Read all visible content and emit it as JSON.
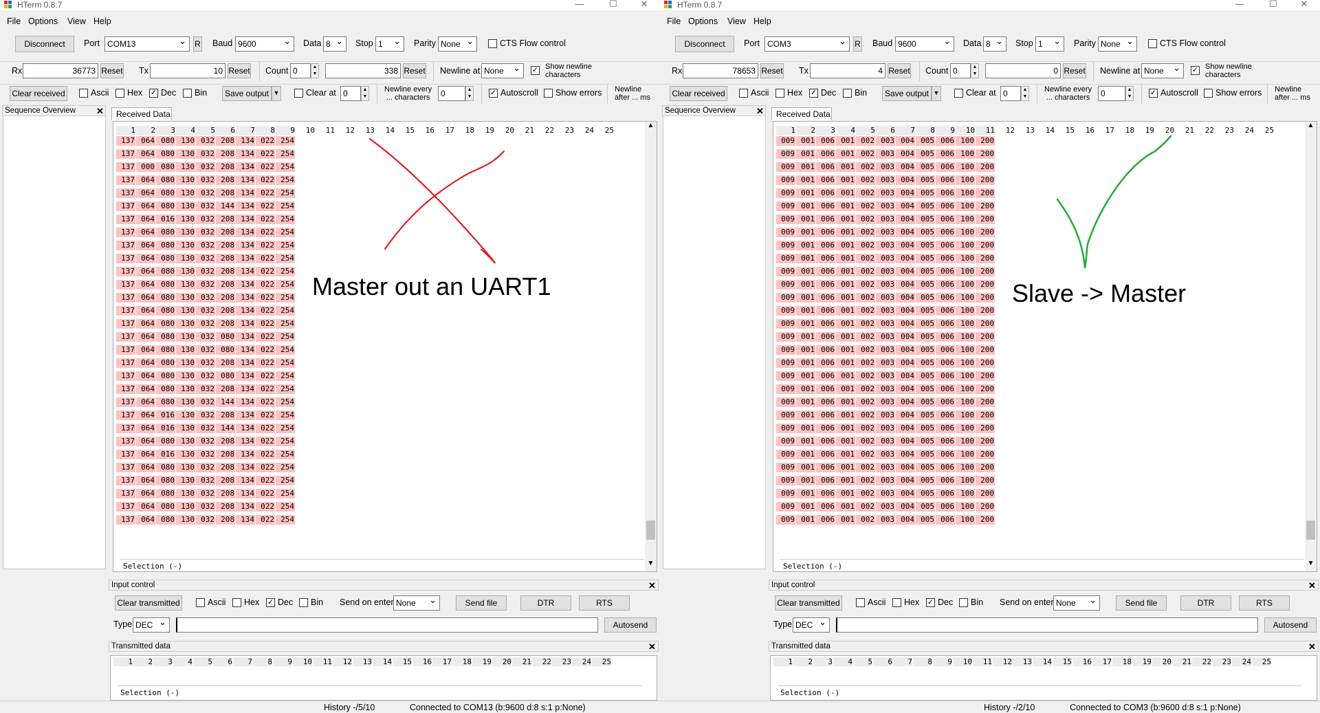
{
  "windows": [
    {
      "title": "HTerm 0.8.7",
      "menu": [
        "File",
        "Options",
        "View",
        "Help"
      ],
      "toolbar1": {
        "connect_label": "Disconnect",
        "port_label": "Port",
        "port_value": "COM13",
        "refresh_label": "R",
        "baud_label": "Baud",
        "baud_value": "9600",
        "data_label": "Data",
        "data_value": "8",
        "stop_label": "Stop",
        "stop_value": "1",
        "parity_label": "Parity",
        "parity_value": "None",
        "cts_label": "CTS Flow control",
        "cts_checked": false
      },
      "toolbar2": {
        "rx_label": "Rx",
        "rx_value": "36773",
        "rx_reset": "Reset",
        "tx_label": "Tx",
        "tx_value": "10",
        "tx_reset": "Reset",
        "count_label": "Count",
        "count_value": "0",
        "count_total": "338",
        "count_reset": "Reset",
        "newline_at_label": "Newline at",
        "newline_at_value": "None",
        "show_newline_line1": "Show newline",
        "show_newline_line2": "characters",
        "show_newline_checked": true
      },
      "toolbar3": {
        "clear_received": "Clear received",
        "ascii": "Ascii",
        "hex": "Hex",
        "dec": "Dec",
        "bin": "Bin",
        "save_output": "Save output",
        "clear_at": "Clear at",
        "clear_at_value": "0",
        "newline_every_line1": "Newline every",
        "newline_every_line2": "... characters",
        "newline_every_value": "0",
        "autoscroll": "Autoscroll",
        "show_errors": "Show errors",
        "newline_after_line1": "Newline",
        "newline_after_line2": "after ... ms"
      },
      "sequence_overview": "Sequence Overview",
      "received_tab": "Received Data",
      "column_headers": [
        "1",
        "2",
        "3",
        "4",
        "5",
        "6",
        "7",
        "8",
        "9",
        "10",
        "11",
        "12",
        "13",
        "14",
        "15",
        "16",
        "17",
        "18",
        "19",
        "20",
        "21",
        "22",
        "23",
        "24",
        "25"
      ],
      "active_columns": 9,
      "rows": [
        [
          "137",
          "064",
          "080",
          "130",
          "032",
          "208",
          "134",
          "022",
          "254"
        ],
        [
          "137",
          "064",
          "080",
          "130",
          "032",
          "208",
          "134",
          "022",
          "254"
        ],
        [
          "137",
          "000",
          "080",
          "130",
          "032",
          "208",
          "134",
          "022",
          "254"
        ],
        [
          "137",
          "064",
          "080",
          "130",
          "032",
          "208",
          "134",
          "022",
          "254"
        ],
        [
          "137",
          "064",
          "080",
          "130",
          "032",
          "208",
          "134",
          "022",
          "254"
        ],
        [
          "137",
          "064",
          "080",
          "130",
          "032",
          "144",
          "134",
          "022",
          "254"
        ],
        [
          "137",
          "064",
          "016",
          "130",
          "032",
          "208",
          "134",
          "022",
          "254"
        ],
        [
          "137",
          "064",
          "080",
          "130",
          "032",
          "208",
          "134",
          "022",
          "254"
        ],
        [
          "137",
          "064",
          "080",
          "130",
          "032",
          "208",
          "134",
          "022",
          "254"
        ],
        [
          "137",
          "064",
          "080",
          "130",
          "032",
          "208",
          "134",
          "022",
          "254"
        ],
        [
          "137",
          "064",
          "080",
          "130",
          "032",
          "208",
          "134",
          "022",
          "254"
        ],
        [
          "137",
          "064",
          "080",
          "130",
          "032",
          "208",
          "134",
          "022",
          "254"
        ],
        [
          "137",
          "064",
          "080",
          "130",
          "032",
          "208",
          "134",
          "022",
          "254"
        ],
        [
          "137",
          "064",
          "080",
          "130",
          "032",
          "208",
          "134",
          "022",
          "254"
        ],
        [
          "137",
          "064",
          "080",
          "130",
          "032",
          "208",
          "134",
          "022",
          "254"
        ],
        [
          "137",
          "064",
          "080",
          "130",
          "032",
          "080",
          "134",
          "022",
          "254"
        ],
        [
          "137",
          "064",
          "080",
          "130",
          "032",
          "080",
          "134",
          "022",
          "254"
        ],
        [
          "137",
          "064",
          "080",
          "130",
          "032",
          "208",
          "134",
          "022",
          "254"
        ],
        [
          "137",
          "064",
          "080",
          "130",
          "032",
          "080",
          "134",
          "022",
          "254"
        ],
        [
          "137",
          "064",
          "080",
          "130",
          "032",
          "208",
          "134",
          "022",
          "254"
        ],
        [
          "137",
          "064",
          "080",
          "130",
          "032",
          "144",
          "134",
          "022",
          "254"
        ],
        [
          "137",
          "064",
          "016",
          "130",
          "032",
          "208",
          "134",
          "022",
          "254"
        ],
        [
          "137",
          "064",
          "016",
          "130",
          "032",
          "144",
          "134",
          "022",
          "254"
        ],
        [
          "137",
          "064",
          "080",
          "130",
          "032",
          "208",
          "134",
          "022",
          "254"
        ],
        [
          "137",
          "064",
          "016",
          "130",
          "032",
          "208",
          "134",
          "022",
          "254"
        ],
        [
          "137",
          "064",
          "080",
          "130",
          "032",
          "208",
          "134",
          "022",
          "254"
        ],
        [
          "137",
          "064",
          "080",
          "130",
          "032",
          "208",
          "134",
          "022",
          "254"
        ],
        [
          "137",
          "064",
          "080",
          "130",
          "032",
          "208",
          "134",
          "022",
          "254"
        ],
        [
          "137",
          "064",
          "080",
          "130",
          "032",
          "208",
          "134",
          "022",
          "254"
        ],
        [
          "137",
          "064",
          "080",
          "130",
          "032",
          "208",
          "134",
          "022",
          "254"
        ]
      ],
      "selection_text": "Selection (-)",
      "input_control": {
        "title": "Input control",
        "clear_transmitted": "Clear transmitted",
        "ascii": "Ascii",
        "hex": "Hex",
        "dec": "Dec",
        "bin": "Bin",
        "send_on_enter_label": "Send on enter",
        "send_on_enter_value": "None",
        "send_file": "Send file",
        "dtr": "DTR",
        "rts": "RTS",
        "type_label": "Type",
        "type_value": "DEC",
        "input_value": "",
        "autosend": "Autosend"
      },
      "transmitted": {
        "title": "Transmitted data",
        "selection_text": "Selection (-)"
      },
      "status": {
        "history": "History -/5/10",
        "connection": "Connected to COM13 (b:9600 d:8 s:1 p:None)"
      },
      "annotation": {
        "text": "Master out an UART1",
        "mark": "cross",
        "mark_color": "#e02020"
      }
    },
    {
      "title": "HTerm 0.8.7",
      "menu": [
        "File",
        "Options",
        "View",
        "Help"
      ],
      "toolbar1": {
        "connect_label": "Disconnect",
        "port_label": "Port",
        "port_value": "COM3",
        "refresh_label": "R",
        "baud_label": "Baud",
        "baud_value": "9600",
        "data_label": "Data",
        "data_value": "8",
        "stop_label": "Stop",
        "stop_value": "1",
        "parity_label": "Parity",
        "parity_value": "None",
        "cts_label": "CTS Flow control",
        "cts_checked": false
      },
      "toolbar2": {
        "rx_label": "Rx",
        "rx_value": "78653",
        "rx_reset": "Reset",
        "tx_label": "Tx",
        "tx_value": "4",
        "tx_reset": "Reset",
        "count_label": "Count",
        "count_value": "0",
        "count_total": "0",
        "count_reset": "Reset",
        "newline_at_label": "Newline at",
        "newline_at_value": "None",
        "show_newline_line1": "Show newline",
        "show_newline_line2": "characters",
        "show_newline_checked": true
      },
      "toolbar3": {
        "clear_received": "Clear received",
        "ascii": "Ascii",
        "hex": "Hex",
        "dec": "Dec",
        "bin": "Bin",
        "save_output": "Save output",
        "clear_at": "Clear at",
        "clear_at_value": "0",
        "newline_every_line1": "Newline every",
        "newline_every_line2": "... characters",
        "newline_every_value": "0",
        "autoscroll": "Autoscroll",
        "show_errors": "Show errors",
        "newline_after_line1": "Newline",
        "newline_after_line2": "after ... ms"
      },
      "sequence_overview": "Sequence Overview",
      "received_tab": "Received Data",
      "column_headers": [
        "1",
        "2",
        "3",
        "4",
        "5",
        "6",
        "7",
        "8",
        "9",
        "10",
        "11",
        "12",
        "13",
        "14",
        "15",
        "16",
        "17",
        "18",
        "19",
        "20",
        "21",
        "22",
        "23",
        "24",
        "25"
      ],
      "active_columns": 11,
      "rows": [
        [
          "009",
          "001",
          "006",
          "001",
          "002",
          "003",
          "004",
          "005",
          "006",
          "100",
          "200"
        ],
        [
          "009",
          "001",
          "006",
          "001",
          "002",
          "003",
          "004",
          "005",
          "006",
          "100",
          "200"
        ],
        [
          "009",
          "001",
          "006",
          "001",
          "002",
          "003",
          "004",
          "005",
          "006",
          "100",
          "200"
        ],
        [
          "009",
          "001",
          "006",
          "001",
          "002",
          "003",
          "004",
          "005",
          "006",
          "100",
          "200"
        ],
        [
          "009",
          "001",
          "006",
          "001",
          "002",
          "003",
          "004",
          "005",
          "006",
          "100",
          "200"
        ],
        [
          "009",
          "001",
          "006",
          "001",
          "002",
          "003",
          "004",
          "005",
          "006",
          "100",
          "200"
        ],
        [
          "009",
          "001",
          "006",
          "001",
          "002",
          "003",
          "004",
          "005",
          "006",
          "100",
          "200"
        ],
        [
          "009",
          "001",
          "006",
          "001",
          "002",
          "003",
          "004",
          "005",
          "006",
          "100",
          "200"
        ],
        [
          "009",
          "001",
          "006",
          "001",
          "002",
          "003",
          "004",
          "005",
          "006",
          "100",
          "200"
        ],
        [
          "009",
          "001",
          "006",
          "001",
          "002",
          "003",
          "004",
          "005",
          "006",
          "100",
          "200"
        ],
        [
          "009",
          "001",
          "006",
          "001",
          "002",
          "003",
          "004",
          "005",
          "006",
          "100",
          "200"
        ],
        [
          "009",
          "001",
          "006",
          "001",
          "002",
          "003",
          "004",
          "005",
          "006",
          "100",
          "200"
        ],
        [
          "009",
          "001",
          "006",
          "001",
          "002",
          "003",
          "004",
          "005",
          "006",
          "100",
          "200"
        ],
        [
          "009",
          "001",
          "006",
          "001",
          "002",
          "003",
          "004",
          "005",
          "006",
          "100",
          "200"
        ],
        [
          "009",
          "001",
          "006",
          "001",
          "002",
          "003",
          "004",
          "005",
          "006",
          "100",
          "200"
        ],
        [
          "009",
          "001",
          "006",
          "001",
          "002",
          "003",
          "004",
          "005",
          "006",
          "100",
          "200"
        ],
        [
          "009",
          "001",
          "006",
          "001",
          "002",
          "003",
          "004",
          "005",
          "006",
          "100",
          "200"
        ],
        [
          "009",
          "001",
          "006",
          "001",
          "002",
          "003",
          "004",
          "005",
          "006",
          "100",
          "200"
        ],
        [
          "009",
          "001",
          "006",
          "001",
          "002",
          "003",
          "004",
          "005",
          "006",
          "100",
          "200"
        ],
        [
          "009",
          "001",
          "006",
          "001",
          "002",
          "003",
          "004",
          "005",
          "006",
          "100",
          "200"
        ],
        [
          "009",
          "001",
          "006",
          "001",
          "002",
          "003",
          "004",
          "005",
          "006",
          "100",
          "200"
        ],
        [
          "009",
          "001",
          "006",
          "001",
          "002",
          "003",
          "004",
          "005",
          "006",
          "100",
          "200"
        ],
        [
          "009",
          "001",
          "006",
          "001",
          "002",
          "003",
          "004",
          "005",
          "006",
          "100",
          "200"
        ],
        [
          "009",
          "001",
          "006",
          "001",
          "002",
          "003",
          "004",
          "005",
          "006",
          "100",
          "200"
        ],
        [
          "009",
          "001",
          "006",
          "001",
          "002",
          "003",
          "004",
          "005",
          "006",
          "100",
          "200"
        ],
        [
          "009",
          "001",
          "006",
          "001",
          "002",
          "003",
          "004",
          "005",
          "006",
          "100",
          "200"
        ],
        [
          "009",
          "001",
          "006",
          "001",
          "002",
          "003",
          "004",
          "005",
          "006",
          "100",
          "200"
        ],
        [
          "009",
          "001",
          "006",
          "001",
          "002",
          "003",
          "004",
          "005",
          "006",
          "100",
          "200"
        ],
        [
          "009",
          "001",
          "006",
          "001",
          "002",
          "003",
          "004",
          "005",
          "006",
          "100",
          "200"
        ],
        [
          "009",
          "001",
          "006",
          "001",
          "002",
          "003",
          "004",
          "005",
          "006",
          "100",
          "200"
        ]
      ],
      "selection_text": "Selection (-)",
      "input_control": {
        "title": "Input control",
        "clear_transmitted": "Clear transmitted",
        "ascii": "Ascii",
        "hex": "Hex",
        "dec": "Dec",
        "bin": "Bin",
        "send_on_enter_label": "Send on enter",
        "send_on_enter_value": "None",
        "send_file": "Send file",
        "dtr": "DTR",
        "rts": "RTS",
        "type_label": "Type",
        "type_value": "DEC",
        "input_value": "",
        "autosend": "Autosend"
      },
      "transmitted": {
        "title": "Transmitted data",
        "selection_text": "Selection (-)"
      },
      "status": {
        "history": "History -/2/10",
        "connection": "Connected to COM3 (b:9600 d:8 s:1 p:None)"
      },
      "annotation": {
        "text": "Slave -> Master",
        "mark": "checkmark",
        "mark_color": "#22aa33"
      }
    }
  ],
  "window_controls": {
    "minimize": "—",
    "maximize": "☐",
    "close": "✕"
  }
}
